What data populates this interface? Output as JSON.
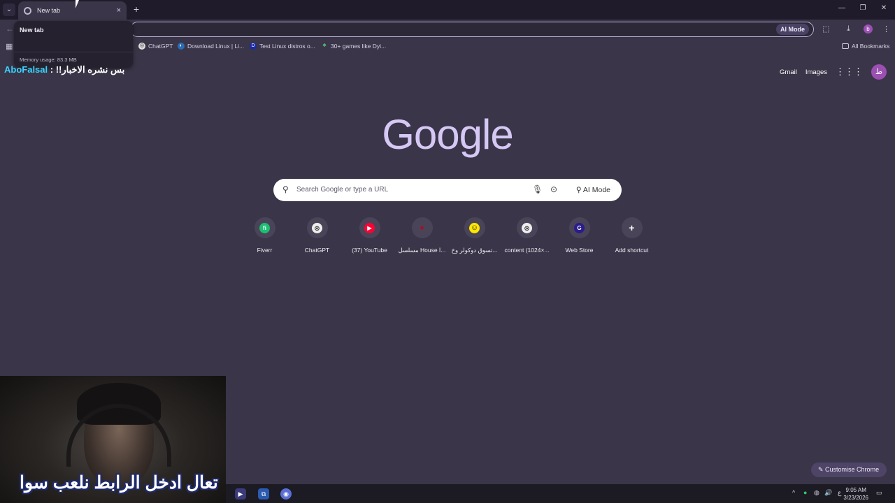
{
  "browser": {
    "tab": {
      "title": "New tab",
      "close": "×"
    },
    "new_tab": "+",
    "hovercard": {
      "title": "New tab",
      "memory": "Memory usage: 83.3 MB"
    },
    "omnibox_ai": "AI Mode",
    "profile_initial": "b",
    "window": {
      "minimize": "—",
      "restore": "❐",
      "close": "✕"
    }
  },
  "bookmarks": {
    "items": [
      {
        "label": "ChatGPT",
        "icon": "openai-icon"
      },
      {
        "label": "Download Linux | Li...",
        "icon": "linux-icon"
      },
      {
        "label": "Test Linux distros o...",
        "icon": "distrosea-icon"
      },
      {
        "label": "30+ games like Dyi...",
        "icon": "leaf-icon"
      }
    ],
    "all_bookmarks": "All Bookmarks"
  },
  "overlay": {
    "name": "AboFalsal",
    "separator": " : ",
    "message": "!!بس نشره الاخبار"
  },
  "ntp": {
    "links": {
      "gmail": "Gmail",
      "images": "Images"
    },
    "avatar": "ط",
    "logo": "Google",
    "search": {
      "placeholder": "Search Google or type a URL",
      "ai_mode": "AI Mode"
    },
    "shortcuts": [
      {
        "label": "Fiverr",
        "glyph": "fi",
        "color": "#1dbf73"
      },
      {
        "label": "ChatGPT",
        "glyph": "◎",
        "color": "#ffffff"
      },
      {
        "label": "(37) YouTube",
        "glyph": "▶",
        "color": "#ff0033"
      },
      {
        "label": "مسلسل House ا...",
        "glyph": "●",
        "color": "#c0001a"
      },
      {
        "label": "تسوق دوكولر وخ...",
        "glyph": "☺",
        "color": "#ffe600"
      },
      {
        "label": "content (1024×...",
        "glyph": "◎",
        "color": "#ffffff"
      },
      {
        "label": "Web Store",
        "glyph": "G",
        "color": "#2a1c8a"
      },
      {
        "label": "Add shortcut",
        "glyph": "+",
        "color": "#4a4458"
      }
    ],
    "customise": "Customise Chrome"
  },
  "stream": {
    "caption": "تعال ادخل الرابط نلعب سوا"
  },
  "taskbar": {
    "time": "9:05 AM",
    "date": "3/23/2026",
    "lang": "ع"
  }
}
